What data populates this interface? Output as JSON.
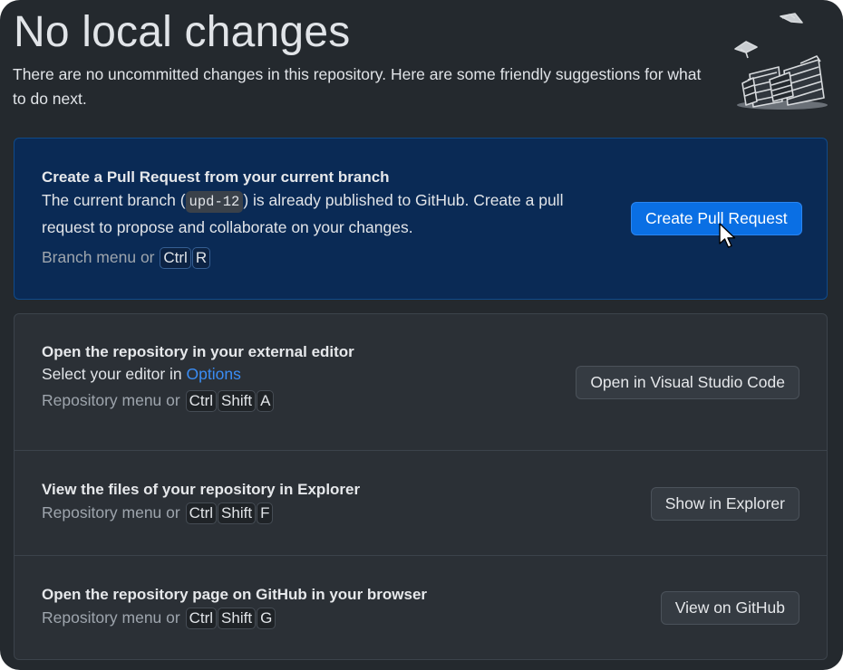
{
  "page": {
    "title": "No local changes",
    "description": "There are no uncommitted changes in this repository. Here are some friendly suggestions for what to do next."
  },
  "pull_request": {
    "title": "Create a Pull Request from your current branch",
    "text_before": "The current branch (",
    "branch": "upd-12",
    "text_after": ") is already published to GitHub. Create a pull request to propose and collaborate on your changes.",
    "hint": "Branch menu or",
    "keys": [
      "Ctrl",
      "R"
    ],
    "button": "Create Pull Request"
  },
  "editor": {
    "title": "Open the repository in your external editor",
    "text": "Select your editor in",
    "link": "Options",
    "hint": "Repository menu or",
    "keys": [
      "Ctrl",
      "Shift",
      "A"
    ],
    "button": "Open in Visual Studio Code"
  },
  "explorer": {
    "title": "View the files of your repository in Explorer",
    "hint": "Repository menu or",
    "keys": [
      "Ctrl",
      "Shift",
      "F"
    ],
    "button": "Show in Explorer"
  },
  "github": {
    "title": "Open the repository page on GitHub in your browser",
    "hint": "Repository menu or",
    "keys": [
      "Ctrl",
      "Shift",
      "G"
    ],
    "button": "View on GitHub"
  },
  "icons": [
    "paper-stacks-illustration",
    "mouse-pointer-icon"
  ],
  "colors": {
    "background": "#24292e",
    "primary_button": "#0a6fe4",
    "link": "#3a8df5",
    "pr_panel": "#0a2a55"
  }
}
